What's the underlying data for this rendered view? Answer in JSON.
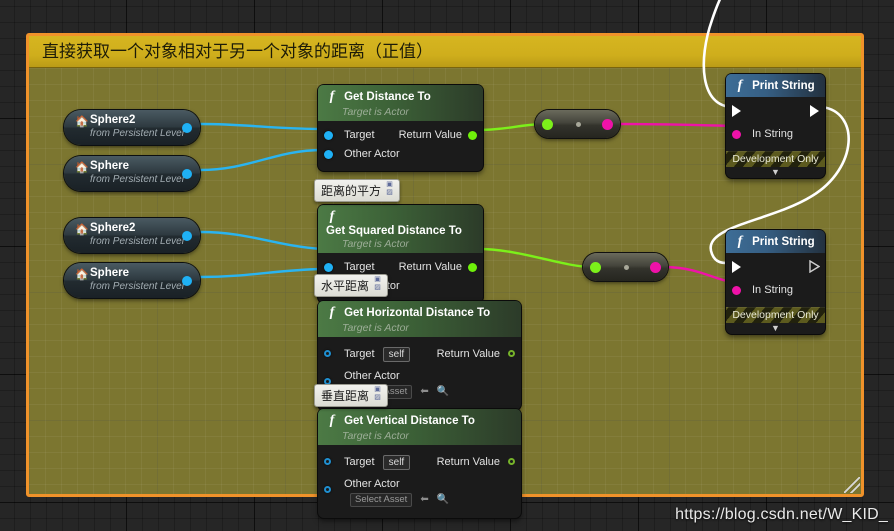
{
  "comment": {
    "title": "直接获取一个对象相对于另一个对象的距离（正值）",
    "border_color": "#f0922a",
    "title_bar_color": "#d0ae1c",
    "fill_color": "#7c7630"
  },
  "watermark": "https://blog.csdn.net/W_KID_",
  "actor_nodes": [
    {
      "name": "Sphere2",
      "subtitle": "from Persistent Level",
      "icon": "actor-icon"
    },
    {
      "name": "Sphere",
      "subtitle": "from Persistent Level",
      "icon": "actor-icon"
    },
    {
      "name": "Sphere2",
      "subtitle": "from Persistent Level",
      "icon": "actor-icon"
    },
    {
      "name": "Sphere",
      "subtitle": "from Persistent Level",
      "icon": "actor-icon"
    }
  ],
  "function_nodes": [
    {
      "title": "Get Distance To",
      "subtitle": "Target is Actor",
      "inputs": [
        {
          "label": "Target",
          "type": "object",
          "connected": true
        },
        {
          "label": "Other Actor",
          "type": "object",
          "connected": true
        }
      ],
      "outputs": [
        {
          "label": "Return Value",
          "type": "float",
          "connected": true
        }
      ]
    },
    {
      "title": "Get Squared Distance To",
      "subtitle": "Target is Actor",
      "inputs": [
        {
          "label": "Target",
          "type": "object",
          "connected": true
        },
        {
          "label": "Other Actor",
          "type": "object",
          "connected": true
        }
      ],
      "outputs": [
        {
          "label": "Return Value",
          "type": "float",
          "connected": true
        }
      ]
    },
    {
      "title": "Get Horizontal Distance To",
      "subtitle": "Target is Actor",
      "inputs": [
        {
          "label": "Target",
          "type": "object",
          "connected": false,
          "default_value": "self"
        },
        {
          "label": "Other Actor",
          "type": "object",
          "connected": false,
          "default_value": "Select Asset"
        }
      ],
      "outputs": [
        {
          "label": "Return Value",
          "type": "float",
          "connected": false
        }
      ]
    },
    {
      "title": "Get Vertical Distance To",
      "subtitle": "Target is Actor",
      "inputs": [
        {
          "label": "Target",
          "type": "object",
          "connected": false,
          "default_value": "self"
        },
        {
          "label": "Other Actor",
          "type": "object",
          "connected": false,
          "default_value": "Select Asset"
        }
      ],
      "outputs": [
        {
          "label": "Return Value",
          "type": "float",
          "connected": false
        }
      ]
    }
  ],
  "print_nodes": [
    {
      "title": "Print String",
      "in_string_label": "In String",
      "dev_only_label": "Development Only",
      "exec_in_filled": true,
      "exec_out_filled": true
    },
    {
      "title": "Print String",
      "in_string_label": "In String",
      "dev_only_label": "Development Only",
      "exec_in_filled": true,
      "exec_out_filled": false
    }
  ],
  "conversion_nodes": [
    {
      "in_type": "float",
      "out_type": "string"
    },
    {
      "in_type": "float",
      "out_type": "string"
    }
  ],
  "sticky_labels": [
    {
      "text": "距离的平方"
    },
    {
      "text": "水平距离"
    },
    {
      "text": "垂直距离"
    }
  ],
  "wire_colors": {
    "object": "#2ab4f0",
    "float": "#7cf01a",
    "string": "#ef12a8",
    "exec": "#ffffff"
  }
}
